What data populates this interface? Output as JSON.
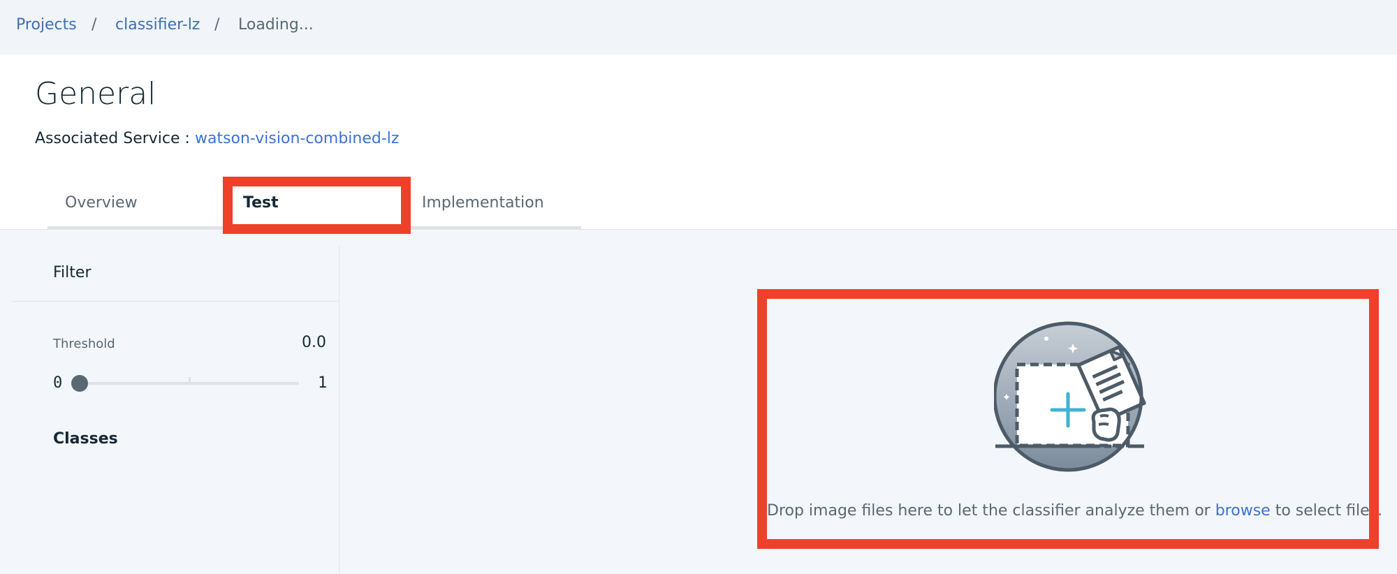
{
  "breadcrumb": {
    "items": [
      "Projects",
      "classifier-lz",
      "Loading..."
    ],
    "separator": "/"
  },
  "header": {
    "title": "General",
    "service_label": "Associated Service :",
    "service_name": "watson-vision-combined-lz"
  },
  "tabs": [
    {
      "label": "Overview",
      "active": false
    },
    {
      "label": "Test",
      "active": true
    },
    {
      "label": "Implementation",
      "active": false
    }
  ],
  "sidebar": {
    "filter_title": "Filter",
    "threshold_label": "Threshold",
    "threshold_value": "0.0",
    "slider": {
      "min_label": "0",
      "max_label": "1",
      "value": 0.0
    },
    "classes_title": "Classes"
  },
  "dropzone": {
    "text_before": "Drop image files here to let the classifier analyze them or",
    "browse_label": "browse",
    "text_after": "to select files.",
    "icon": "image-drop-icon"
  },
  "colors": {
    "link": "#3b73d6",
    "highlight": "#ee412a",
    "accent_plus": "#41b3d0"
  }
}
